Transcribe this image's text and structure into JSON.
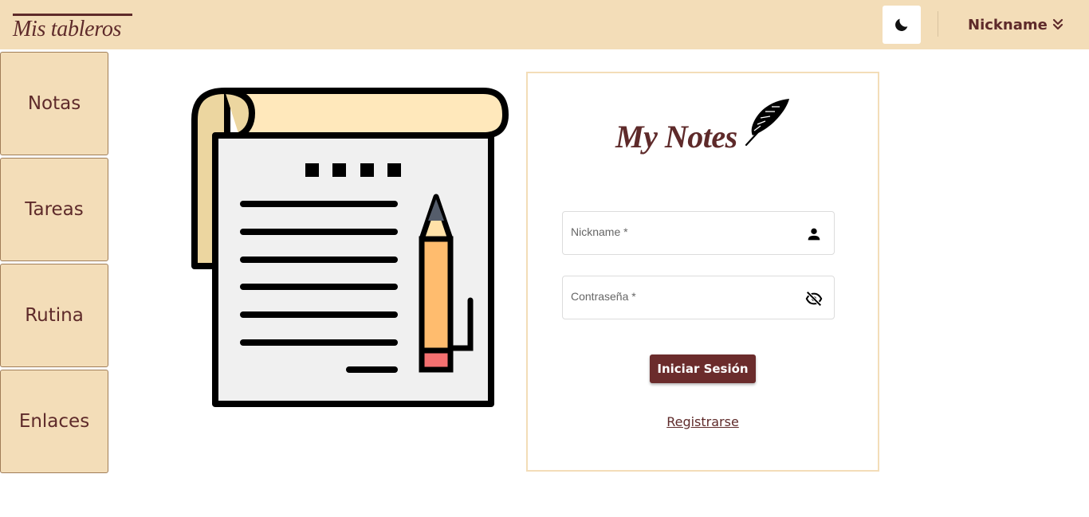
{
  "header": {
    "brand": "Mis tableros",
    "theme_toggle_icon": "moon-icon",
    "user_menu_label": "Nickname",
    "user_menu_icon": "double-chevron-down-icon"
  },
  "sidebar": {
    "items": [
      {
        "label": "Notas"
      },
      {
        "label": "Tareas"
      },
      {
        "label": "Rutina"
      },
      {
        "label": "Enlaces"
      }
    ]
  },
  "illustration": {
    "icon": "notepad-pencil-icon"
  },
  "login": {
    "logo_text": "My Notes",
    "logo_icon": "feather-icon",
    "nickname": {
      "label": "Nickname *",
      "value": "",
      "icon": "person-icon"
    },
    "password": {
      "label": "Contraseña *",
      "value": "",
      "icon": "eye-off-icon"
    },
    "submit_label": "Iniciar Sesión",
    "register_label": "Registrarse"
  },
  "colors": {
    "accent": "#5e2a2a",
    "button": "#6b2c2c",
    "header_bg": "#f3ddb8",
    "card_border": "#f3ddb8"
  }
}
